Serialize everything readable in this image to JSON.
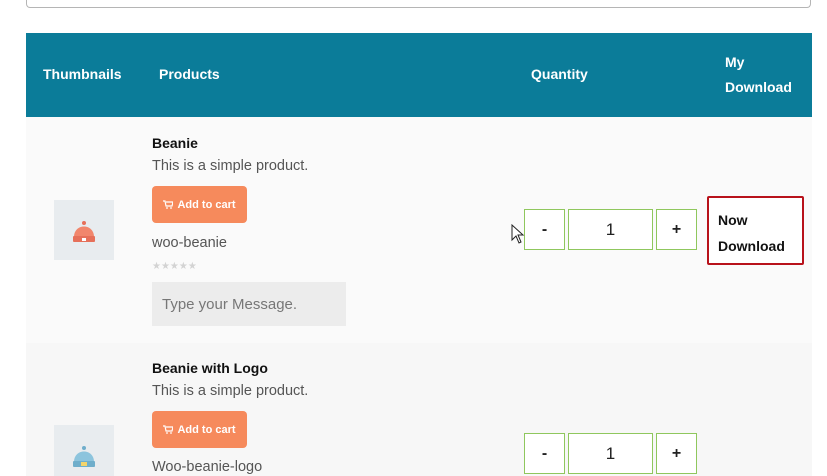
{
  "table": {
    "headers": {
      "thumbnails": "Thumbnails",
      "products": "Products",
      "quantity": "Quantity",
      "download": "My Download"
    },
    "rows": [
      {
        "name": "Beanie",
        "description": "This is a simple product.",
        "add_to_cart": "Add to cart",
        "slug": "woo-beanie",
        "stars": "★★★★★",
        "message_placeholder": "Type your Message.",
        "qty_minus": "-",
        "qty_value": "1",
        "qty_plus": "+",
        "download_label": "Now Download",
        "thumb_color": "#f1866c"
      },
      {
        "name": "Beanie with Logo",
        "description": "This is a simple product.",
        "add_to_cart": "Add to cart",
        "slug": "Woo-beanie-logo",
        "qty_minus": "-",
        "qty_value": "1",
        "qty_plus": "+",
        "thumb_color": "#8cc4dd"
      }
    ]
  },
  "colors": {
    "header_bg": "#0b7c99",
    "cart_button": "#f68a5c",
    "qty_border": "#8fc75d",
    "download_border": "#b8121b"
  }
}
